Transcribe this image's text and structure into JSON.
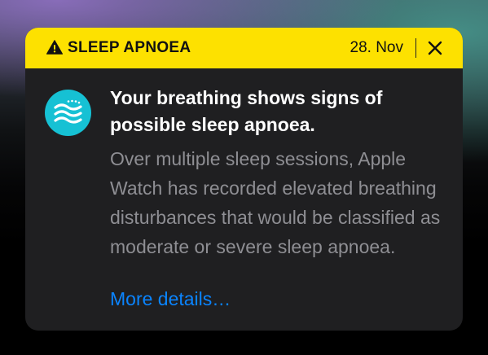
{
  "notification": {
    "category_label": "SLEEP APNOEA",
    "date": "28. Nov",
    "headline": "Your breathing shows signs of possible sleep apnoea.",
    "body": "Over multiple sleep sessions, Apple Watch has recorded elevated breathing disturbances that would be classified as moderate or severe sleep apnoea.",
    "link_label": "More details…",
    "icons": {
      "warning": "warning-triangle-icon",
      "close": "close-icon",
      "app": "breathing-waves-icon"
    },
    "colors": {
      "banner": "#fde100",
      "card": "#1f1f21",
      "headline": "#ffffff",
      "body": "#8e8e93",
      "link": "#0a84ff",
      "app_icon": "#16c1d4"
    }
  }
}
